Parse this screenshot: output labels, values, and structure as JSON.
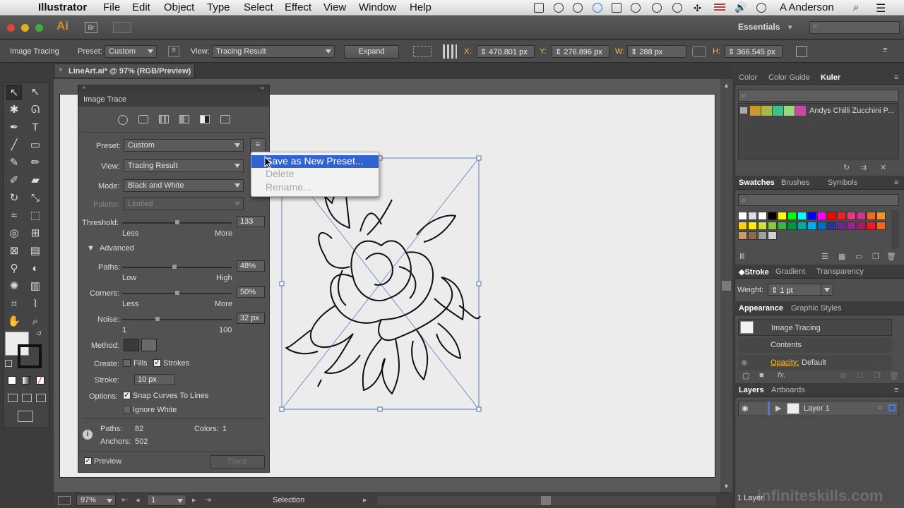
{
  "menubar": {
    "app": "Illustrator",
    "items": [
      "File",
      "Edit",
      "Object",
      "Type",
      "Select",
      "Effect",
      "View",
      "Window",
      "Help"
    ],
    "user": "A Anderson"
  },
  "appbar": {
    "logo": "Ai",
    "bridge": "Br",
    "workspace": "Essentials"
  },
  "control": {
    "label": "Image Tracing",
    "preset_label": "Preset:",
    "preset": "Custom",
    "view_label": "View:",
    "view": "Tracing Result",
    "expand": "Expand",
    "x_label": "X:",
    "x": "470.801 px",
    "y_label": "Y:",
    "y": "276.896 px",
    "w_label": "W:",
    "w": "288 px",
    "h_label": "H:",
    "h": "366.545 px"
  },
  "doc": {
    "tab": "LineArt.ai* @ 97% (RGB/Preview)"
  },
  "trace": {
    "title": "Image Trace",
    "preset_label": "Preset:",
    "preset": "Custom",
    "view_label": "View:",
    "view": "Tracing Result",
    "mode_label": "Mode:",
    "mode": "Black and White",
    "palette_label": "Palette:",
    "palette": "Limited",
    "threshold_label": "Threshold:",
    "threshold": "133",
    "threshold_min": "Less",
    "threshold_max": "More",
    "threshold_level": 0.5,
    "advanced": "Advanced",
    "paths_label": "Paths:",
    "paths": "48%",
    "paths_min": "Low",
    "paths_max": "High",
    "paths_level": 0.48,
    "corners_label": "Corners:",
    "corners": "50%",
    "corners_min": "Less",
    "corners_max": "More",
    "corners_level": 0.5,
    "noise_label": "Noise:",
    "noise": "32 px",
    "noise_min": "1",
    "noise_max": "100",
    "noise_level": 0.32,
    "method_label": "Method:",
    "create_label": "Create:",
    "fills": "Fills",
    "strokes": "Strokes",
    "stroke_label": "Stroke:",
    "stroke": "10 px",
    "options_label": "Options:",
    "snap": "Snap Curves To Lines",
    "ignore_white": "Ignore White",
    "stat_paths_label": "Paths:",
    "stat_paths": "82",
    "stat_colors_label": "Colors:",
    "stat_colors": "1",
    "stat_anchors_label": "Anchors:",
    "stat_anchors": "502",
    "preview": "Preview",
    "trace_btn": "Trace"
  },
  "preset_menu": {
    "items": [
      "Save as New Preset...",
      "Delete",
      "Rename..."
    ]
  },
  "status": {
    "zoom": "97%",
    "page": "1",
    "tool": "Selection"
  },
  "panels": {
    "color_tabs": [
      "Color",
      "Color Guide",
      "Kuler"
    ],
    "kuler_theme": "Andys  Chilli Zucchini P...",
    "kuler_colors": [
      "#c89a2e",
      "#a8b84a",
      "#3dc08a",
      "#9ad87a",
      "#c84aa0"
    ],
    "swatch_tabs": [
      "Swatches",
      "Brushes",
      "Symbols"
    ],
    "swatch_colors": [
      "#000000",
      "#ffff00",
      "#00ff00",
      "#00ffff",
      "#0000ff",
      "#ff00ff",
      "#ff0000",
      "#e8232b",
      "#e83a7a",
      "#c8378b",
      "#ef6a2b",
      "#f7941d",
      "#fcd116",
      "#ffee00",
      "#cfe03b",
      "#8dc63f",
      "#39b54a",
      "#009444",
      "#00a99d",
      "#00aeef",
      "#0072bc",
      "#2e3192",
      "#662d91",
      "#92278f",
      "#9e1f63",
      "#ed1c24",
      "#f26522",
      "#c69c6d",
      "#8b6b4a",
      "#a0a0a0",
      "#d0d0d0"
    ],
    "stroke_tabs": [
      "Stroke",
      "Gradient",
      "Transparency"
    ],
    "weight_label": "Weight:",
    "weight": "1 pt",
    "appearance_tabs": [
      "Appearance",
      "Graphic Styles"
    ],
    "appearance_item": "Image Tracing",
    "contents": "Contents",
    "opacity_label": "Opacity:",
    "opacity": "Default",
    "layers_tabs": [
      "Layers",
      "Artboards"
    ],
    "layer": "Layer 1",
    "layers_count": "1 Layer"
  },
  "watermark": "infiniteskills.com"
}
